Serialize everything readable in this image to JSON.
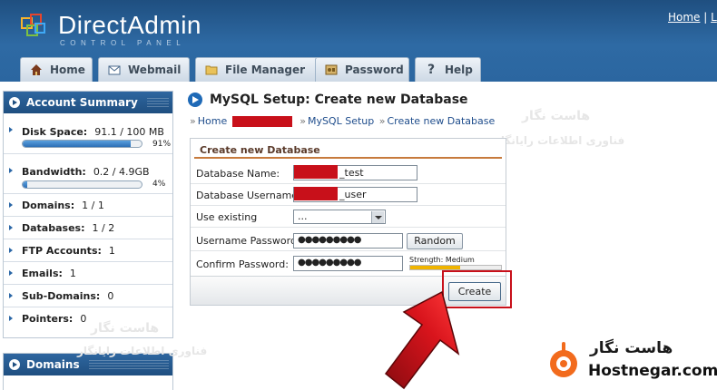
{
  "header": {
    "logo_title": "DirectAdmin",
    "logo_sub": "CONTROL PANEL",
    "link_home": "Home",
    "link_sep": "|",
    "link_l": "L"
  },
  "tabs": [
    {
      "label": "Home",
      "icon": "house-icon"
    },
    {
      "label": "Webmail",
      "icon": "envelope-icon"
    },
    {
      "label": "File Manager",
      "icon": "folder-icon"
    },
    {
      "label": "Password",
      "icon": "key-icon"
    },
    {
      "label": "Help",
      "icon": "question-icon"
    }
  ],
  "account_summary": {
    "title": "Account Summary",
    "disk_label": "Disk Space:",
    "disk_value": "91.1 / 100 MB",
    "disk_pct_text": "91%",
    "disk_fraction": 0.91,
    "bandwidth_label": "Bandwidth:",
    "bandwidth_value": "0.2 / 4.9GB",
    "bandwidth_pct_text": "4%",
    "bandwidth_fraction": 0.04,
    "rows": [
      {
        "label": "Domains:",
        "value": "1 / 1"
      },
      {
        "label": "Databases:",
        "value": "1 / 2"
      },
      {
        "label": "FTP Accounts:",
        "value": "1"
      },
      {
        "label": "Emails:",
        "value": "1"
      },
      {
        "label": "Sub-Domains:",
        "value": "0"
      },
      {
        "label": "Pointers:",
        "value": "0"
      }
    ]
  },
  "domains_panel": {
    "title": "Domains"
  },
  "main": {
    "title": "MySQL Setup: Create new Database",
    "crumb_home": "Home",
    "crumb_mysql": "MySQL Setup",
    "crumb_create": "Create new Database"
  },
  "form": {
    "title": "Create new Database",
    "db_name_label": "Database Name:",
    "db_name_suffix": "_test",
    "db_user_label": "Database Username:",
    "db_user_suffix": "_user",
    "use_existing_label": "Use existing",
    "use_existing_value": "...",
    "user_pass_label": "Username Password:",
    "user_pass_value": "●●●●●●●●●",
    "random_button": "Random",
    "confirm_label": "Confirm Password:",
    "confirm_value": "●●●●●●●●●",
    "strength_label": "Strength: Medium",
    "strength_fraction": 0.55,
    "create_button": "Create"
  },
  "watermark": {
    "fa_name": "هاست نگار",
    "fa_tagline": "فناوری اطلاعات رایانگار"
  },
  "brand": {
    "name_fa": "هاست نگار",
    "name_en": "Hostnegar.com",
    "color": "#f26b1d"
  },
  "colors": {
    "header_blue": "#2b66a0",
    "highlight_red": "#c8101a",
    "arrow_red": "#c8101a"
  }
}
